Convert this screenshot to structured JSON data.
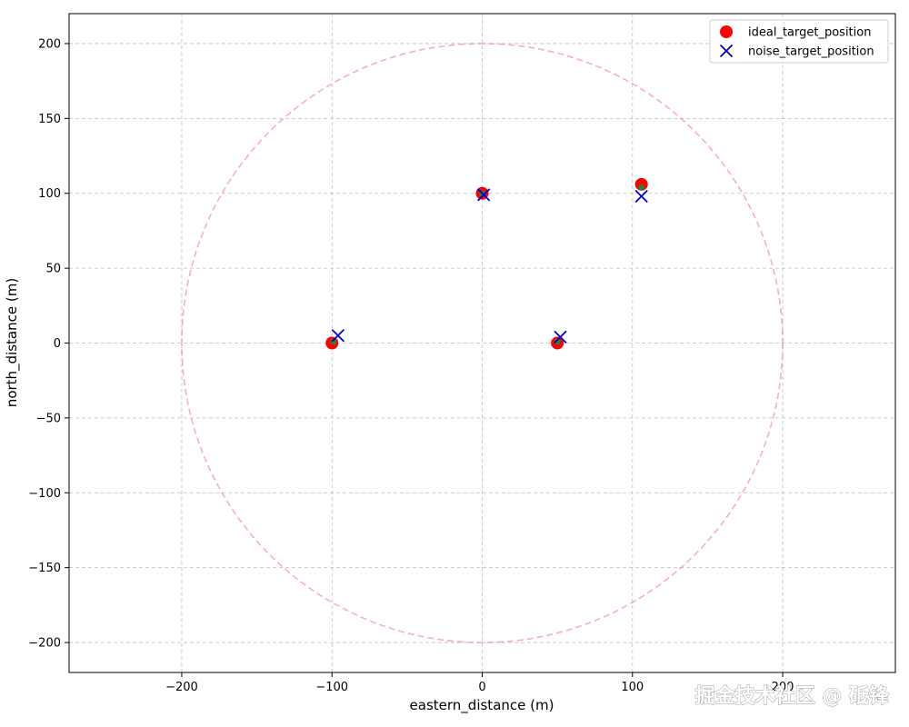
{
  "chart_data": {
    "type": "scatter",
    "title": "",
    "xlabel": "eastern_distance (m)",
    "ylabel": "north_distance (m)",
    "xlim": [
      -275,
      275
    ],
    "ylim": [
      -220,
      220
    ],
    "xticks": [
      -200,
      -100,
      0,
      100,
      200
    ],
    "yticks": [
      -200,
      -150,
      -100,
      -50,
      0,
      50,
      100,
      150,
      200
    ],
    "grid": true,
    "legend_position": "top-right",
    "circle": {
      "center": [
        0,
        0
      ],
      "radius": 200,
      "color": "#f08080",
      "style": "dashed"
    },
    "series": [
      {
        "name": "ideal_target_position",
        "marker": "circle",
        "color": "#ff0000",
        "points": [
          [
            -100,
            0
          ],
          [
            0,
            100
          ],
          [
            50,
            0
          ],
          [
            106,
            106
          ]
        ]
      },
      {
        "name": "noise_target_position",
        "marker": "x",
        "color": "#0000cc",
        "points": [
          [
            -96,
            5
          ],
          [
            1,
            99
          ],
          [
            52,
            4
          ],
          [
            106,
            98
          ]
        ]
      }
    ],
    "estimate_markers": {
      "color": "#2e7d32",
      "points": [
        [
          -99,
          1
        ],
        [
          0,
          100
        ],
        [
          50,
          1
        ],
        [
          106,
          104
        ]
      ]
    }
  },
  "watermark": "掘金技术社区 @ 砥锋"
}
